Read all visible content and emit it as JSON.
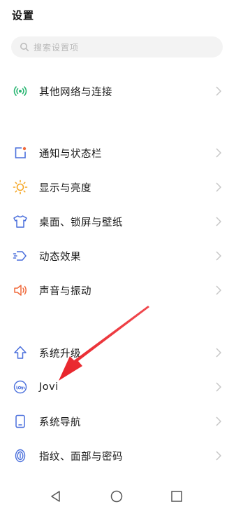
{
  "header": {
    "title": "设置"
  },
  "search": {
    "placeholder": "搜索设置项"
  },
  "sections": [
    {
      "items": [
        {
          "label": "其他网络与连接",
          "icon": "network-connection-icon",
          "icon_color": "#2bb673"
        }
      ]
    },
    {
      "items": [
        {
          "label": "通知与状态栏",
          "icon": "notification-icon",
          "icon_color": "#4a6fdc"
        },
        {
          "label": "显示与亮度",
          "icon": "brightness-icon",
          "icon_color": "#f5a623"
        },
        {
          "label": "桌面、锁屏与壁纸",
          "icon": "wallpaper-icon",
          "icon_color": "#4a6fdc"
        },
        {
          "label": "动态效果",
          "icon": "motion-effects-icon",
          "icon_color": "#4a6fdc"
        },
        {
          "label": "声音与振动",
          "icon": "sound-icon",
          "icon_color": "#f06a3c"
        }
      ]
    },
    {
      "items": [
        {
          "label": "系统升级",
          "icon": "system-upgrade-icon",
          "icon_color": "#4a6fdc"
        },
        {
          "label": "Jovi",
          "icon": "jovi-icon",
          "icon_color": "#4a6fdc"
        },
        {
          "label": "系统导航",
          "icon": "system-navigation-icon",
          "icon_color": "#4a6fdc"
        },
        {
          "label": "指纹、面部与密码",
          "icon": "fingerprint-icon",
          "icon_color": "#4a6fdc"
        }
      ]
    }
  ],
  "colors": {
    "accent_blue": "#4a6fdc",
    "annotation_arrow": "#e8232a",
    "chevron": "#c8c8c8",
    "nav": "#555555"
  },
  "navbar": {
    "buttons": [
      "back-icon",
      "home-icon",
      "recents-icon"
    ]
  }
}
